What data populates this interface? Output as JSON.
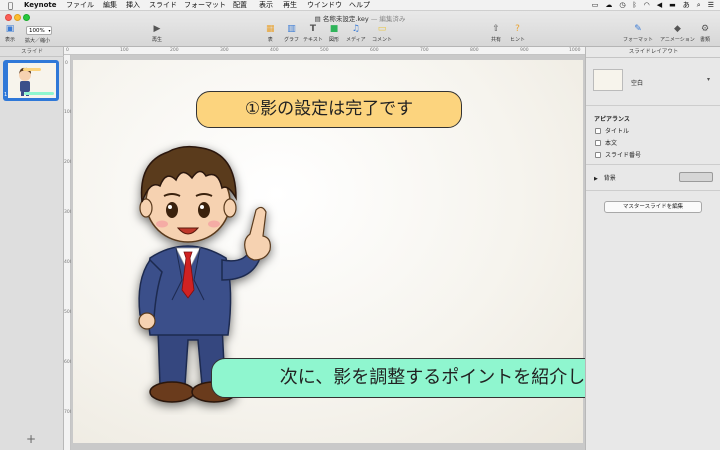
{
  "menubar": {
    "app_name": "Keynote",
    "items": [
      "ファイル",
      "編集",
      "挿入",
      "スライド",
      "フォーマット",
      "配置",
      "表示",
      "再生",
      "ウインドウ",
      "ヘルプ"
    ]
  },
  "window": {
    "title": "名称未設定.key",
    "subtitle": "— 編集済み"
  },
  "toolbar": {
    "view_label": "表示",
    "zoom_value": "100%",
    "zoom_label": "拡大／縮小",
    "play_label": "再生",
    "table_label": "表",
    "chart_label": "グラフ",
    "text_label": "テキスト",
    "shape_label": "図形",
    "media_label": "メディア",
    "comment_label": "コメント",
    "share_label": "共有",
    "tips_label": "ヒント",
    "format_label": "フォーマット",
    "animate_label": "アニメーション",
    "document_label": "書類"
  },
  "navigator": {
    "header": "スライド",
    "slide_number": "1"
  },
  "ruler": {
    "top_ticks": [
      "0",
      "100",
      "200",
      "300",
      "400",
      "500",
      "600",
      "700",
      "800",
      "900",
      "1000"
    ],
    "left_ticks": [
      "0",
      "100",
      "200",
      "300",
      "400",
      "500",
      "600",
      "700"
    ]
  },
  "slide": {
    "bubble_top": "①影の設定は完了です",
    "bubble_bottom": "次に、影を調整するポイントを紹介します"
  },
  "inspector": {
    "header": "スライドレイアウト",
    "layout_name": "空白",
    "appearance_title": "アピアランス",
    "checkbox_title": "タイトル",
    "checkbox_body": "本文",
    "checkbox_number": "スライド番号",
    "background_label": "背景",
    "master_button": "マスタースライドを編集"
  },
  "colors": {
    "bubble_top": "#fcd47e",
    "bubble_bottom": "#8ff6cf",
    "suit": "#3a4f8a",
    "tie": "#d02020",
    "selection": "#2f78d8"
  }
}
